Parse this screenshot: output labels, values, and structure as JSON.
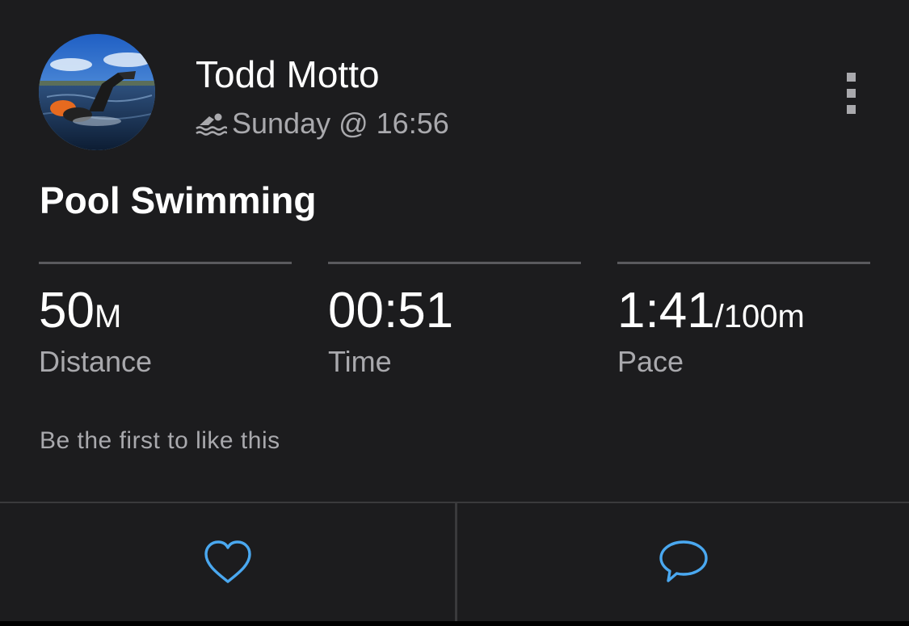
{
  "post": {
    "user_name": "Todd Motto",
    "activity_icon": "swimmer-icon",
    "activity_time": "Sunday @ 16:56",
    "title": "Pool Swimming"
  },
  "stats": [
    {
      "value": "50",
      "unit": "M",
      "label": "Distance"
    },
    {
      "value": "00:51",
      "unit": "",
      "label": "Time"
    },
    {
      "value": "1:41",
      "unit": "/100m",
      "label": "Pace"
    }
  ],
  "likes_text": "Be the first to like this",
  "actions": {
    "like_icon": "heart-icon",
    "comment_icon": "speech-bubble-icon",
    "accent_color": "#4aa8f0"
  },
  "colors": {
    "background": "#1c1c1e",
    "secondary_text": "#a9a9ad",
    "divider": "#3a3a3c"
  }
}
